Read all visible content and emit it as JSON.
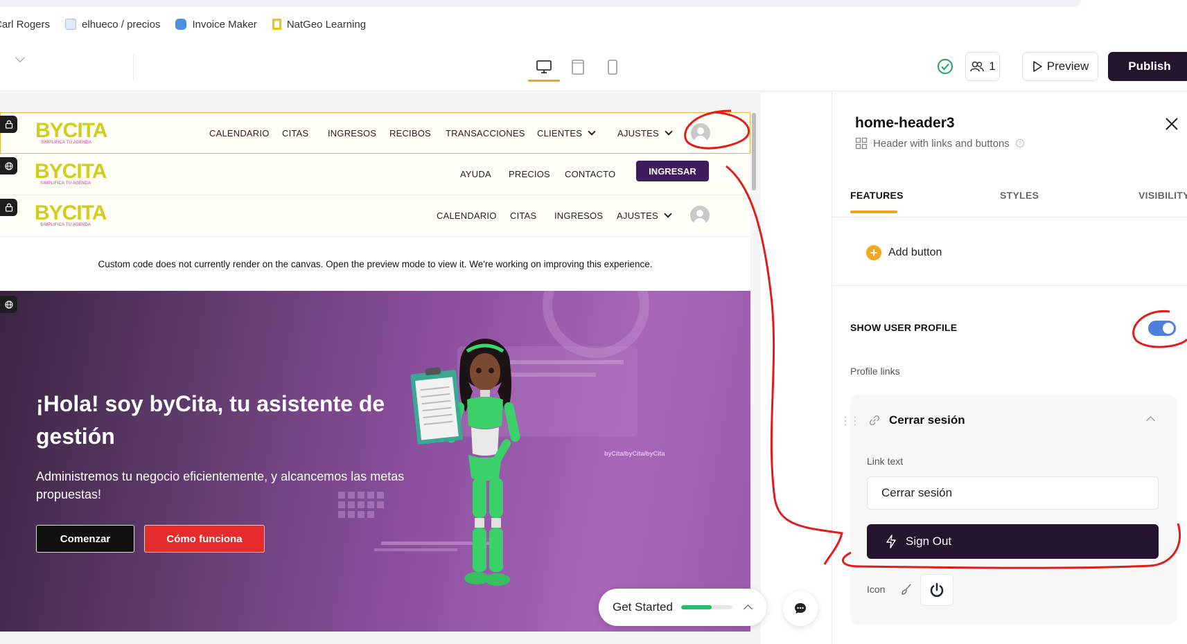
{
  "bookmarks": [
    {
      "label": "Carl Rogers"
    },
    {
      "label": "elhueco / precios"
    },
    {
      "label": "Invoice Maker"
    },
    {
      "label": "NatGeo Learning"
    }
  ],
  "toolbar": {
    "collaborators_count": "1",
    "preview_label": "Preview",
    "publish_label": "Publish"
  },
  "canvas": {
    "logo": {
      "main": "BYCITA",
      "sub": "SIMPLIFICA TU AGENDA"
    },
    "header_private": {
      "links": [
        "CALENDARIO",
        "CITAS",
        "INGRESOS",
        "RECIBOS",
        "TRANSACCIONES"
      ],
      "clientes": "CLIENTES",
      "ajustes": "AJUSTES"
    },
    "header_public": {
      "links": [
        "AYUDA",
        "PRECIOS",
        "CONTACTO"
      ],
      "cta": "INGRESAR"
    },
    "header_private_small": {
      "links": [
        "CALENDARIO",
        "CITAS",
        "INGRESOS"
      ],
      "ajustes": "AJUSTES"
    },
    "notice": "Custom code does not currently render on the canvas. Open the preview mode to view it. We're working on improving this experience.",
    "hero": {
      "title": "¡Hola! soy byCita, tu asistente de gestión",
      "subtitle": "Administremos tu negocio eficientemente, y alcancemos las metas propuestas!",
      "btn_primary": "Comenzar",
      "btn_secondary": "Cómo funciona",
      "deco_text": "byCita/byCita/byCita"
    },
    "get_started": {
      "label": "Get Started",
      "progress": 0.6
    }
  },
  "panel": {
    "component_name": "home-header3",
    "component_desc": "Header with links and buttons",
    "tabs": {
      "features": "FEATURES",
      "styles": "STYLES",
      "visibility": "VISIBILITY"
    },
    "add_button_label": "Add button",
    "show_user_profile_label": "SHOW USER PROFILE",
    "show_user_profile_on": true,
    "profile_links_label": "Profile links",
    "link": {
      "title": "Cerrar sesión",
      "link_text_label": "Link text",
      "link_text_value": "Cerrar sesión",
      "action_label": "Sign Out",
      "icon_label": "Icon"
    }
  },
  "colors": {
    "accent": "#f0a41e",
    "publish_bg": "#24142e",
    "brand_purple": "#3f1d5c",
    "toggle_on": "#4f7fe0",
    "annotation_red": "#e41b1b"
  }
}
